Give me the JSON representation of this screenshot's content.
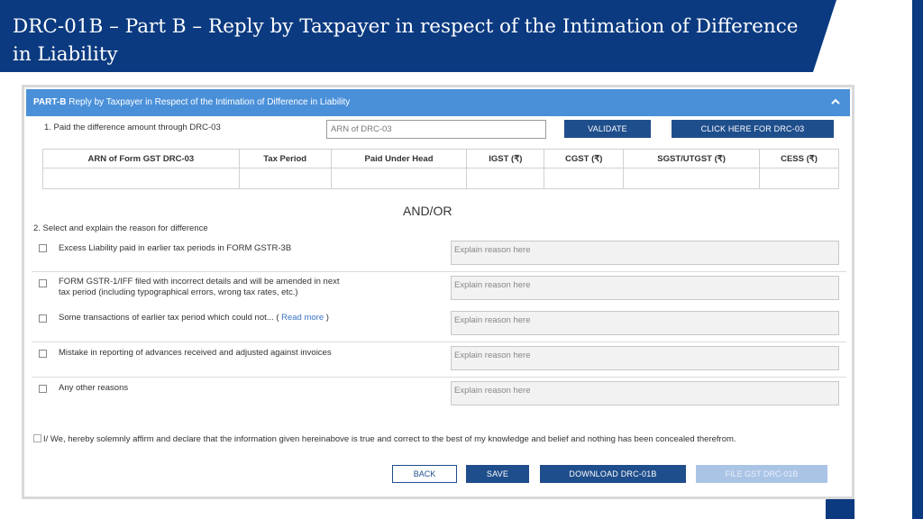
{
  "slide": {
    "title": "DRC-01B – Part B – Reply by Taxpayer in respect of the Intimation of Difference in Liability"
  },
  "panel": {
    "header_bold": "PART-B",
    "header_rest": " Reply by Taxpayer in Respect of the Intimation of Difference in Liability",
    "section1_label": "1. Paid the difference amount through DRC-03",
    "arn_placeholder": "ARN of DRC-03",
    "validate_label": "VALIDATE",
    "click_here_label": "CLICK HERE FOR DRC-03",
    "table_headers": [
      "ARN of Form GST DRC-03",
      "Tax Period",
      "Paid Under Head",
      "IGST (₹)",
      "CGST (₹)",
      "SGST/UTGST (₹)",
      "CESS (₹)"
    ],
    "andor": "AND/OR",
    "section2_label": "2. Select and explain the reason for difference",
    "reason_placeholder": "Explain reason here",
    "reasons": [
      {
        "line1": "Excess Liability paid in earlier tax periods in FORM GSTR-3B",
        "line2": ""
      },
      {
        "line1": "FORM GSTR-1/IFF filed with incorrect details and will be amended in next",
        "line2": "tax period (including typographical errors, wrong tax rates, etc.)"
      },
      {
        "line1": "Some transactions of earlier tax period which could not... (",
        "link": "Read more",
        "after": " )"
      },
      {
        "line1": "Mistake in reporting of advances received and adjusted against invoices",
        "line2": ""
      },
      {
        "line1": "Any other reasons",
        "line2": ""
      }
    ],
    "declaration": "I/ We, hereby solemnly affirm and declare that the information given hereinabove is true and correct to the best of my knowledge and belief and nothing has been concealed therefrom.",
    "buttons": {
      "back": "BACK",
      "save": "SAVE",
      "download": "DOWNLOAD DRC-01B",
      "file": "FILE GST DRC-01B"
    }
  },
  "colors": {
    "slide_navy": "#0b3a80",
    "panel_header": "#4a90d9",
    "button_primary": "#1f4e8c",
    "button_disabled": "#aac4e6"
  },
  "icons": {
    "collapse": "chevron-up-icon",
    "checkbox": "checkbox-icon"
  }
}
